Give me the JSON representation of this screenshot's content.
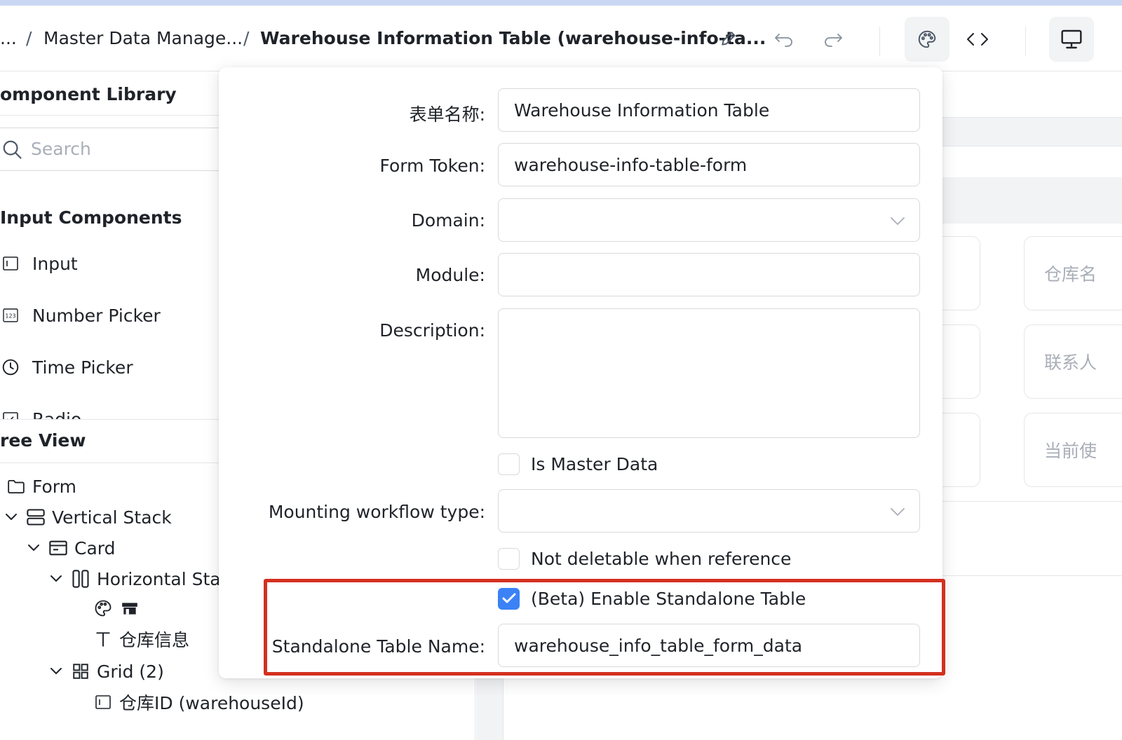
{
  "breadcrumb": {
    "ellipsis": "...",
    "separator": "/",
    "parent": "Master Data Manage...",
    "current": "Warehouse Information Table (warehouse-info-ta..."
  },
  "icons": {
    "edit": "pencil-icon",
    "undo": "undo-icon",
    "redo": "redo-icon",
    "theme": "palette-icon",
    "code": "code-icon",
    "preview": "desktop-icon"
  },
  "sidebar": {
    "library_title": "omponent Library",
    "search_placeholder": "Search",
    "section_title": "Input Components",
    "components": [
      {
        "label": "Input",
        "icon": "input-icon"
      },
      {
        "label": "Number Picker",
        "icon": "number-icon"
      },
      {
        "label": "Time Picker",
        "icon": "clock-icon"
      },
      {
        "label": "Radio",
        "icon": "checkbox-icon"
      }
    ],
    "tree_title": "ree View",
    "tree": [
      {
        "label": "Form",
        "icon": "folder-icon"
      },
      {
        "label": "Vertical Stack",
        "icon": "vertical-stack-icon"
      },
      {
        "label": "Card",
        "icon": "card-icon"
      },
      {
        "label": "Horizontal Stac",
        "icon": "horizontal-stack-icon"
      },
      {
        "label": "",
        "icon": "palette-icon"
      },
      {
        "label": "仓库信息",
        "icon": "text-icon"
      },
      {
        "label": "Grid (2)",
        "icon": "grid-icon"
      },
      {
        "label": "仓库ID (warehouseId)",
        "icon": "input-icon"
      }
    ]
  },
  "canvas": {
    "ghost_labels": [
      "仓库名",
      "联系人",
      "当前使"
    ]
  },
  "form": {
    "name_label": "表单名称:",
    "name_value": "Warehouse Information Table",
    "token_label": "Form Token:",
    "token_value": "warehouse-info-table-form",
    "domain_label": "Domain:",
    "domain_value": "",
    "module_label": "Module:",
    "module_value": "",
    "description_label": "Description:",
    "description_value": "",
    "is_master_label": "Is Master Data",
    "is_master_checked": false,
    "workflow_label": "Mounting workflow type:",
    "workflow_value": "",
    "not_deletable_label": "Not deletable when reference",
    "not_deletable_checked": false,
    "standalone_label": "(Beta) Enable Standalone Table",
    "standalone_checked": true,
    "table_name_label": "Standalone Table Name:",
    "table_name_value": "warehouse_info_table_form_data"
  },
  "colors": {
    "accent": "#3b82f6",
    "highlight": "#d4301f"
  }
}
